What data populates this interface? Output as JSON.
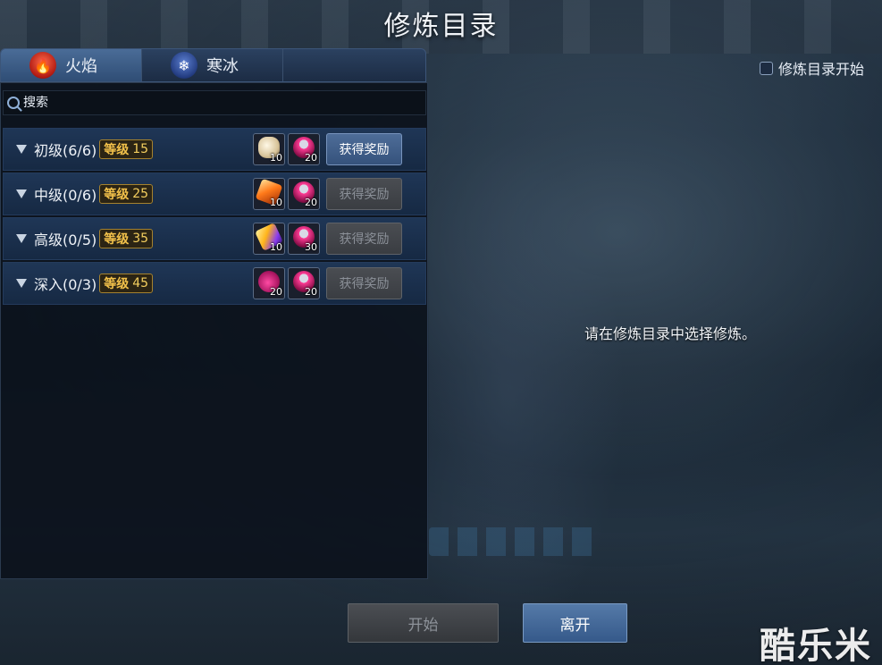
{
  "window": {
    "title": "修炼目录"
  },
  "tabs": [
    {
      "label": "火焰",
      "icon": "fire-icon",
      "active": true
    },
    {
      "label": "寒冰",
      "icon": "snowflake-icon",
      "active": false
    }
  ],
  "auto_start": {
    "label": "修炼目录开始",
    "checked": false
  },
  "search": {
    "placeholder": "搜索",
    "value": ""
  },
  "list": {
    "rows": [
      {
        "label": "初级(6/6)",
        "level_label": "等级",
        "level": "15",
        "rewards": [
          {
            "icon": "scroll-icon",
            "count": "10"
          },
          {
            "icon": "potion-pot-icon",
            "count": "20"
          }
        ],
        "button_label": "获得奖励",
        "button_enabled": true
      },
      {
        "label": "中级(0/6)",
        "level_label": "等级",
        "level": "25",
        "rewards": [
          {
            "icon": "wand-icon",
            "count": "10"
          },
          {
            "icon": "potion-pot-icon",
            "count": "20"
          }
        ],
        "button_label": "获得奖励",
        "button_enabled": false
      },
      {
        "label": "高级(0/5)",
        "level_label": "等级",
        "level": "35",
        "rewards": [
          {
            "icon": "gem-icon",
            "count": "10"
          },
          {
            "icon": "potion-pot-icon",
            "count": "30"
          }
        ],
        "button_label": "获得奖励",
        "button_enabled": false
      },
      {
        "label": "深入(0/3)",
        "level_label": "等级",
        "level": "45",
        "rewards": [
          {
            "icon": "potion-icon",
            "count": "20"
          },
          {
            "icon": "potion-pot-icon",
            "count": "20"
          }
        ],
        "button_label": "获得奖励",
        "button_enabled": false
      }
    ]
  },
  "detail": {
    "message": "请在修炼目录中选择修炼。"
  },
  "footer": {
    "start_label": "开始",
    "leave_label": "离开"
  },
  "watermark": {
    "text": "酷乐米"
  },
  "colors": {
    "accent": "#35527c",
    "level_gold": "#f2c14a",
    "disabled": "#3a3d42"
  }
}
